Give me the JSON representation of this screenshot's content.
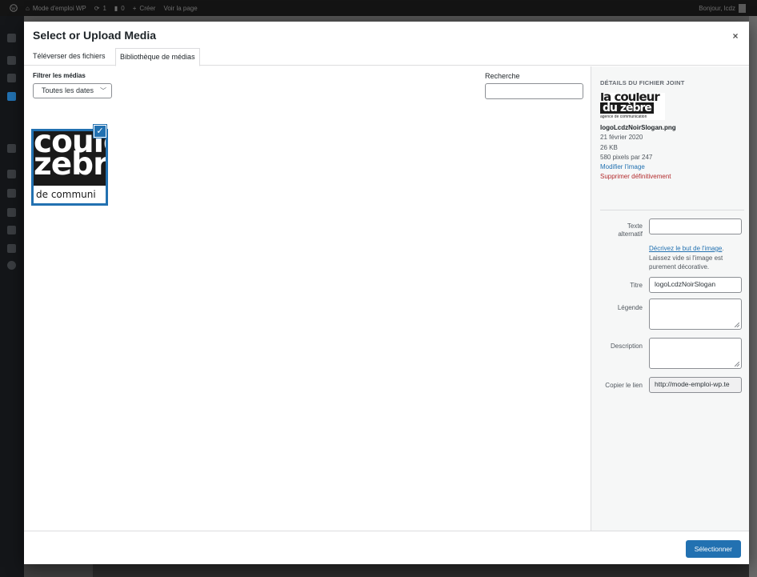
{
  "adminbar": {
    "site_name": "Mode d'emploi WP",
    "updates": "1",
    "comments": "0",
    "new_label": "Créer",
    "view_label": "Voir la page",
    "greeting": "Bonjour, lcdz"
  },
  "modal": {
    "title": "Select or Upload Media",
    "close_symbol": "×"
  },
  "tabs": {
    "upload": "Téléverser des fichiers",
    "library": "Bibliothèque de médias"
  },
  "filters": {
    "label": "Filtrer les médias",
    "date_selected": "Toutes les dates",
    "search_label": "Recherche",
    "search_value": ""
  },
  "attachment": {
    "thumb_line1": "coule",
    "thumb_line2": "zebr",
    "thumb_line3": "de communi",
    "check_symbol": "✓"
  },
  "details": {
    "heading": "DÉTAILS DU FICHIER JOINT",
    "logo_line1": "la couleur",
    "logo_line2": "du zèbre",
    "logo_line3": "agence de communication",
    "filename": "logoLcdzNoirSlogan.png",
    "date": "21 février 2020",
    "size": "26 KB",
    "dimensions": "580 pixels par 247",
    "edit_link": "Modifier l'image",
    "delete_link": "Supprimer définitivement"
  },
  "fields": {
    "alt_label_1": "Texte",
    "alt_label_2": "alternatif",
    "alt_value": "",
    "alt_help_link": "Décrivez le but de l'image",
    "alt_help_text": ". Laissez vide si l'image est purement décorative.",
    "title_label": "Titre",
    "title_value": "logoLcdzNoirSlogan",
    "caption_label": "Légende",
    "caption_value": "",
    "description_label": "Description",
    "description_value": "",
    "copy_link_label": "Copier le lien",
    "copy_link_value": "http://mode-emploi-wp.te"
  },
  "toolbar": {
    "select_label": "Sélectionner"
  },
  "colors": {
    "accent": "#2271b1",
    "danger": "#b32d2e"
  }
}
